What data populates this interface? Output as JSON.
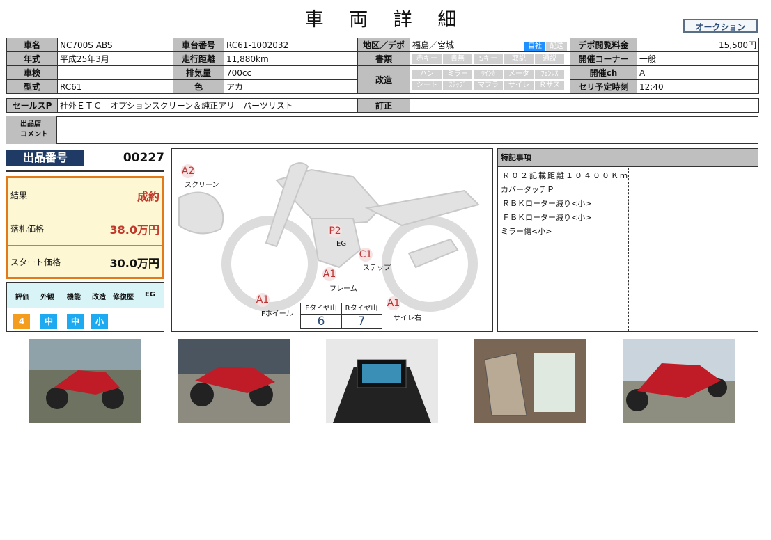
{
  "title": "車 両 詳 細",
  "auction_button": "オークション",
  "spec": {
    "name_label": "車名",
    "name": "NC700S ABS",
    "frame_label": "車台番号",
    "frame": "RC61-1002032",
    "area_label": "地区／デポ",
    "area": "福島／宮城",
    "area_badges": [
      "自社",
      "配送"
    ],
    "fee_label": "デポ閲覧料金",
    "fee": "15,500円",
    "year_label": "年式",
    "year": "平成25年3月",
    "mileage_label": "走行距離",
    "mileage": "11,880km",
    "docs_label": "書類",
    "docs_badges": [
      "赤キー",
      "書無",
      "Sキー",
      "取説",
      "通説"
    ],
    "corner_label": "開催コーナー",
    "corner": "一般",
    "inspection_label": "車検",
    "inspection": "",
    "displacement_label": "排気量",
    "displacement": "700cc",
    "mods_label": "改造",
    "mods_badges": [
      "ハン",
      "ミラー",
      "ｳｲﾝｶ",
      "メータ",
      "ﾌｪﾝﾚｽ",
      "シート",
      "ｽﾃｯﾌﾟ",
      "マフラ",
      "サイレ",
      "Ｒサス"
    ],
    "channel_label": "開催ch",
    "channel": "A",
    "model_label": "型式",
    "model": "RC61",
    "color_label": "色",
    "color": "アカ",
    "time_label": "セリ予定時刻",
    "time": "12:40"
  },
  "sales": {
    "label": "セールスP",
    "text": "社外ＥＴＣ　オプションスクリーン＆純正アリ　パーツリスト",
    "correction_label": "訂正",
    "correction": ""
  },
  "comment": {
    "label_1": "出品店",
    "label_2": "コメント",
    "text": ""
  },
  "lot": {
    "label": "出品番号",
    "number": "00227"
  },
  "result": {
    "result_label": "結果",
    "result": "成約",
    "hammer_label": "落札価格",
    "hammer": "38.0万円",
    "start_label": "スタート価格",
    "start": "30.0万円"
  },
  "evaluation": {
    "headers": [
      "評価",
      "外観",
      "機能",
      "改造",
      "修復歴",
      "EG"
    ],
    "values": [
      "4",
      "中",
      "中",
      "小"
    ],
    "colors": {
      "score": "#f39c1e",
      "grade": "#1eaaf0"
    }
  },
  "diagram": {
    "marks": [
      {
        "code": "A2",
        "label": "スクリーン"
      },
      {
        "code": "P2",
        "label": "EG"
      },
      {
        "code": "C1",
        "label": "ステップ"
      },
      {
        "code": "A1",
        "label": "フレーム"
      },
      {
        "code": "A1",
        "label": "Fホイール"
      },
      {
        "code": "A1",
        "label": "サイレ右"
      }
    ],
    "tire": {
      "front_label": "Fタイヤ山",
      "front": "6",
      "rear_label": "Rタイヤ山",
      "rear": "7"
    }
  },
  "notes": {
    "label": "特記事項",
    "items": [
      "Ｒ０２記載距離１０４００Ｋｍ",
      "カバータッチＰ",
      "ＲＢＫローター減り<小>",
      "ＦＢＫローター減り<小>",
      "ミラー傷<小>"
    ]
  }
}
